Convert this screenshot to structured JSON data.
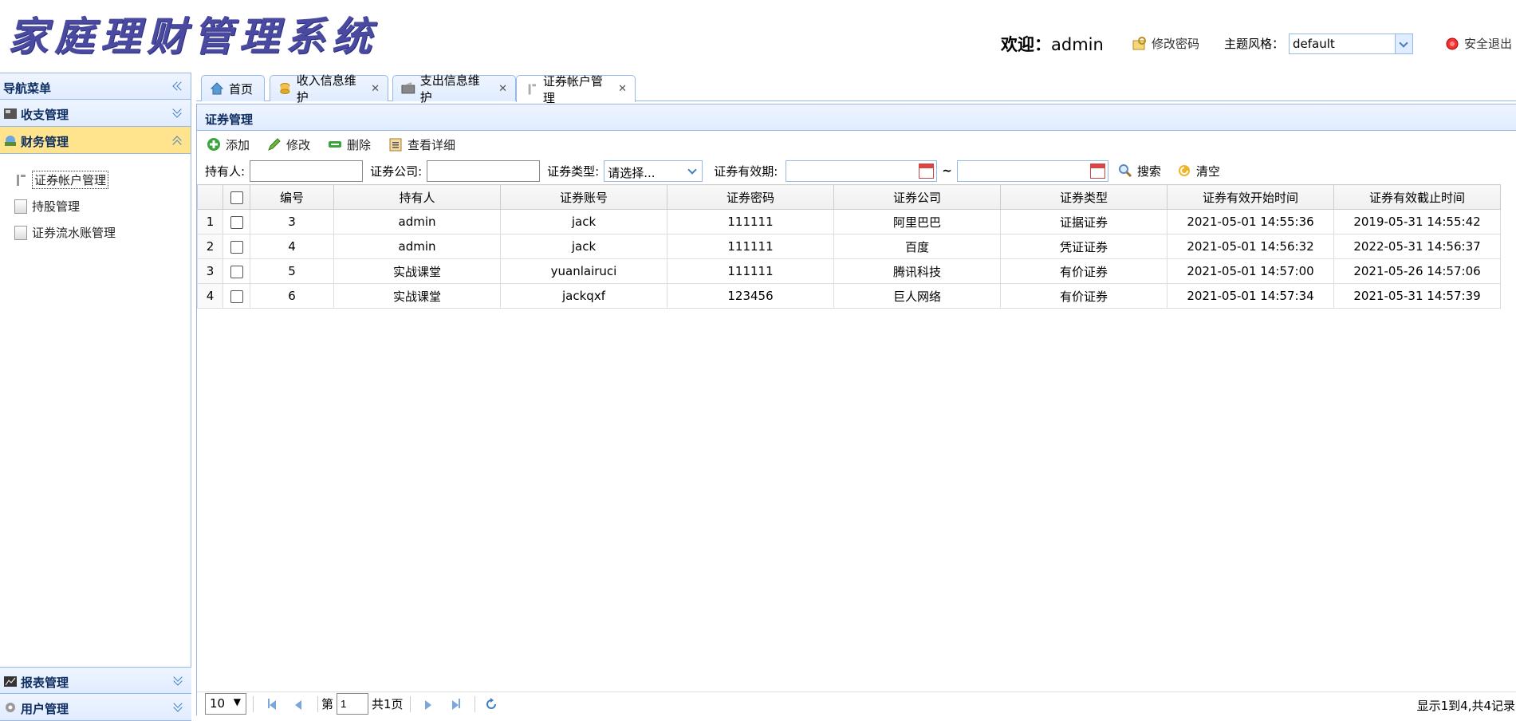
{
  "header": {
    "app_title": "家庭理财管理系统",
    "welcome_label": "欢迎：",
    "username": "admin",
    "change_password": "修改密码",
    "theme_label": "主题风格：",
    "theme_value": "default",
    "logout": "安全退出"
  },
  "nav": {
    "title": "导航菜单",
    "groups": [
      {
        "label": "收支管理",
        "expanded": false
      },
      {
        "label": "财务管理",
        "expanded": true,
        "items": [
          "证券帐户管理",
          "持股管理",
          "证券流水账管理"
        ]
      },
      {
        "label": "报表管理",
        "expanded": false
      },
      {
        "label": "用户管理",
        "expanded": false
      }
    ]
  },
  "tabs": [
    {
      "label": "首页",
      "closable": false
    },
    {
      "label": "收入信息维护",
      "closable": true
    },
    {
      "label": "支出信息维护",
      "closable": true
    },
    {
      "label": "证券帐户管理",
      "closable": true,
      "active": true
    }
  ],
  "panel": {
    "title": "证券管理",
    "toolbar": {
      "add": "添加",
      "edit": "修改",
      "delete": "删除",
      "detail": "查看详细"
    },
    "search": {
      "holder_label": "持有人:",
      "company_label": "证券公司:",
      "type_label": "证券类型:",
      "type_value": "请选择...",
      "validity_label": "证券有效期:",
      "tilde": "~",
      "search_button": "搜索",
      "clear_button": "清空"
    }
  },
  "grid": {
    "columns": [
      "编号",
      "持有人",
      "证券账号",
      "证券密码",
      "证券公司",
      "证券类型",
      "证券有效开始时间",
      "证券有效截止时间"
    ],
    "rows": [
      {
        "rn": "1",
        "id": "3",
        "holder": "admin",
        "account": "jack",
        "password": "111111",
        "company": "阿里巴巴",
        "type": "证据证券",
        "start": "2021-05-01 14:55:36",
        "end": "2019-05-31 14:55:42"
      },
      {
        "rn": "2",
        "id": "4",
        "holder": "admin",
        "account": "jack",
        "password": "111111",
        "company": "百度",
        "type": "凭证证券",
        "start": "2021-05-01 14:56:32",
        "end": "2022-05-31 14:56:37"
      },
      {
        "rn": "3",
        "id": "5",
        "holder": "实战课堂",
        "account": "yuanlairuci",
        "password": "111111",
        "company": "腾讯科技",
        "type": "有价证券",
        "start": "2021-05-01 14:57:00",
        "end": "2021-05-26 14:57:06"
      },
      {
        "rn": "4",
        "id": "6",
        "holder": "实战课堂",
        "account": "jackqxf",
        "password": "123456",
        "company": "巨人网络",
        "type": "有价证券",
        "start": "2021-05-01 14:57:34",
        "end": "2021-05-31 14:57:39"
      }
    ]
  },
  "pager": {
    "page_size": "10",
    "page_prefix": "第",
    "page_value": "1",
    "page_total": "共1页",
    "info": "显示1到4,共4记录"
  }
}
